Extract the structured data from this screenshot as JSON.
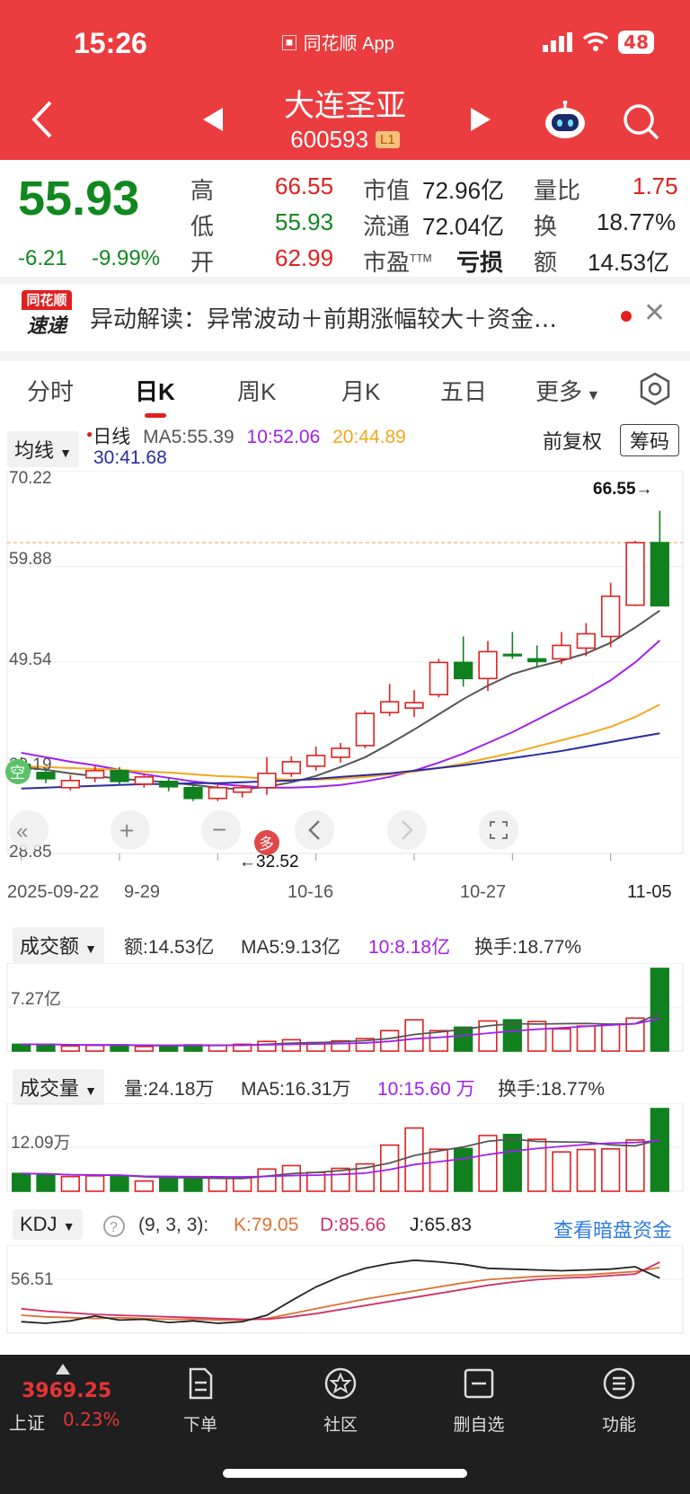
{
  "status": {
    "time": "15:26",
    "app": "同花顺 App",
    "battery": "48"
  },
  "header": {
    "name": "大连圣亚",
    "code": "600593",
    "level_badge": "L1"
  },
  "quote": {
    "price": "55.93",
    "change": "-6.21",
    "change_pct": "-9.99%",
    "high_label": "高",
    "high": "66.55",
    "low_label": "低",
    "low": "55.93",
    "open_label": "开",
    "open": "62.99",
    "mktcap_label": "市值",
    "mktcap": "72.96亿",
    "float_label": "流通",
    "float": "72.04亿",
    "pe_label": "市盈",
    "pe_sup": "TTM",
    "pe": "亏损",
    "volratio_label": "量比",
    "volratio": "1.75",
    "turnover_label": "换",
    "turnover": "18.77%",
    "amount_label": "额",
    "amount": "14.53亿"
  },
  "news": {
    "logo_top": "同花顺",
    "logo_bottom": "速递",
    "text": "异动解读：异常波动＋前期涨幅较大＋资金…"
  },
  "tabs": [
    "分时",
    "日K",
    "周K",
    "月K",
    "五日",
    "更多"
  ],
  "kline": {
    "dropdown": "均线",
    "series_label": "日线",
    "ma5": "MA5:55.39",
    "ma10": "10:52.06",
    "ma20": "20:44.89",
    "ma30": "30:41.68",
    "adjust": "前复权",
    "chip_button": "筹码",
    "y_labels": [
      "70.22",
      "59.88",
      "49.54",
      "39.19",
      "28.85"
    ],
    "x_labels": [
      "2025-09-22",
      "9-29",
      "10-16",
      "10-27",
      "11-05"
    ],
    "high_marker": "66.55→",
    "low_marker": "←32.52",
    "signal_kong": "空",
    "signal_duo": "多",
    "colors": {
      "up": "#e02020",
      "down": "#11801f",
      "ma5": "#555555",
      "ma10": "#a020f0",
      "ma20": "#f2a81d",
      "ma30": "#2b2ba0"
    }
  },
  "chart_data": [
    {
      "type": "candlestick",
      "title": "日线",
      "x_ticks": [
        "2025-09-22",
        "9-29",
        "10-16",
        "10-27",
        "11-05"
      ],
      "ylim": [
        28.85,
        70.22
      ],
      "candles": [
        {
          "o": 38.2,
          "c": 37.5,
          "h": 39.0,
          "l": 36.8
        },
        {
          "o": 37.3,
          "c": 36.6,
          "h": 37.8,
          "l": 36.1
        },
        {
          "o": 35.6,
          "c": 36.4,
          "h": 37.0,
          "l": 35.3
        },
        {
          "o": 36.7,
          "c": 37.5,
          "h": 38.1,
          "l": 36.2
        },
        {
          "o": 37.5,
          "c": 36.3,
          "h": 37.9,
          "l": 35.9
        },
        {
          "o": 36.0,
          "c": 36.8,
          "h": 37.2,
          "l": 35.6
        },
        {
          "o": 36.3,
          "c": 35.7,
          "h": 36.7,
          "l": 35.2
        },
        {
          "o": 35.6,
          "c": 34.4,
          "h": 35.9,
          "l": 34.1
        },
        {
          "o": 34.4,
          "c": 35.6,
          "h": 35.9,
          "l": 34.1
        },
        {
          "o": 35.1,
          "c": 35.6,
          "h": 35.9,
          "l": 34.5
        },
        {
          "o": 35.6,
          "c": 37.2,
          "h": 39.0,
          "l": 34.8
        },
        {
          "o": 37.2,
          "c": 38.5,
          "h": 39.1,
          "l": 36.8
        },
        {
          "o": 38.0,
          "c": 39.2,
          "h": 40.2,
          "l": 37.5
        },
        {
          "o": 39.0,
          "c": 40.0,
          "h": 40.6,
          "l": 38.4
        },
        {
          "o": 40.3,
          "c": 43.9,
          "h": 44.2,
          "l": 40.0
        },
        {
          "o": 44.0,
          "c": 45.2,
          "h": 47.2,
          "l": 43.6
        },
        {
          "o": 44.5,
          "c": 45.1,
          "h": 46.5,
          "l": 43.5
        },
        {
          "o": 46.0,
          "c": 49.6,
          "h": 50.0,
          "l": 45.7
        },
        {
          "o": 49.6,
          "c": 47.8,
          "h": 52.5,
          "l": 46.9
        },
        {
          "o": 47.8,
          "c": 50.8,
          "h": 52.0,
          "l": 46.4
        },
        {
          "o": 50.5,
          "c": 50.4,
          "h": 53.0,
          "l": 50.0
        },
        {
          "o": 50.0,
          "c": 49.7,
          "h": 51.5,
          "l": 49.0
        },
        {
          "o": 50.0,
          "c": 51.5,
          "h": 53.0,
          "l": 49.4
        },
        {
          "o": 51.2,
          "c": 52.8,
          "h": 54.0,
          "l": 50.3
        },
        {
          "o": 52.5,
          "c": 57.0,
          "h": 58.5,
          "l": 51.3
        },
        {
          "o": 56.0,
          "c": 62.99,
          "h": 63.2,
          "l": 55.9
        },
        {
          "o": 62.99,
          "c": 55.93,
          "h": 66.55,
          "l": 55.93
        }
      ],
      "series": [
        {
          "name": "MA5",
          "values": [
            37.9,
            37.6,
            37.2,
            36.9,
            36.6,
            36.4,
            36.2,
            35.9,
            35.6,
            35.4,
            35.7,
            36.2,
            36.9,
            37.9,
            39.0,
            40.5,
            42.1,
            43.8,
            45.5,
            47.0,
            48.3,
            49.1,
            49.8,
            50.6,
            51.8,
            53.5,
            55.39
          ]
        },
        {
          "name": "MA10",
          "values": [
            39.5,
            39.0,
            38.5,
            38.1,
            37.6,
            37.1,
            36.7,
            36.3,
            36.0,
            35.8,
            35.6,
            35.6,
            35.7,
            35.9,
            36.3,
            36.8,
            37.5,
            38.4,
            39.4,
            40.6,
            41.8,
            43.2,
            44.6,
            46.0,
            47.6,
            49.6,
            52.06
          ]
        },
        {
          "name": "MA20",
          "values": [
            38.0,
            37.9,
            37.8,
            37.7,
            37.6,
            37.4,
            37.3,
            37.1,
            36.9,
            36.8,
            36.6,
            36.5,
            36.5,
            36.6,
            36.8,
            37.1,
            37.4,
            37.8,
            38.3,
            38.9,
            39.5,
            40.2,
            40.9,
            41.6,
            42.4,
            43.5,
            44.89
          ]
        },
        {
          "name": "MA30",
          "values": [
            35.5,
            35.6,
            35.7,
            35.8,
            35.9,
            36.0,
            36.0,
            36.1,
            36.1,
            36.2,
            36.3,
            36.4,
            36.6,
            36.8,
            37.0,
            37.2,
            37.5,
            37.8,
            38.1,
            38.5,
            38.9,
            39.3,
            39.7,
            40.2,
            40.7,
            41.2,
            41.68
          ]
        }
      ]
    },
    {
      "type": "bar",
      "title": "成交额",
      "ylabel": "7.27亿",
      "values": [
        1.2,
        1.2,
        0.9,
        1.0,
        1.1,
        0.8,
        1.0,
        1.1,
        1.0,
        1.2,
        1.7,
        2.0,
        1.5,
        1.8,
        2.2,
        3.6,
        5.5,
        3.6,
        4.2,
        5.3,
        5.5,
        5.2,
        3.9,
        4.4,
        4.7,
        5.8,
        14.53
      ],
      "up": [
        false,
        false,
        true,
        true,
        false,
        true,
        false,
        false,
        true,
        true,
        true,
        true,
        true,
        true,
        true,
        true,
        true,
        true,
        false,
        true,
        false,
        true,
        true,
        true,
        true,
        true,
        false
      ]
    },
    {
      "type": "bar",
      "title": "成交量",
      "ylabel": "12.09万",
      "values": [
        5.2,
        5.0,
        4.3,
        4.5,
        4.4,
        3.0,
        3.8,
        3.9,
        3.9,
        4.0,
        6.5,
        7.5,
        5.5,
        6.7,
        8.0,
        13.5,
        18.5,
        12.3,
        12.5,
        16.3,
        16.6,
        15.2,
        11.5,
        12.2,
        12.4,
        15.0,
        24.18
      ],
      "up": [
        false,
        false,
        true,
        true,
        false,
        true,
        false,
        false,
        true,
        true,
        true,
        true,
        true,
        true,
        true,
        true,
        true,
        true,
        false,
        true,
        false,
        true,
        true,
        true,
        true,
        true,
        false
      ]
    },
    {
      "type": "line",
      "title": "KDJ",
      "ylabel": "56.51",
      "series": [
        {
          "name": "K",
          "values": [
            20,
            18,
            17,
            16,
            17,
            16,
            15,
            15,
            14,
            14,
            16,
            22,
            28,
            34,
            40,
            45,
            50,
            55,
            60,
            64,
            66,
            68,
            69,
            70,
            72,
            74,
            79.05
          ]
        },
        {
          "name": "D",
          "values": [
            28,
            25,
            23,
            21,
            20,
            19,
            18,
            17,
            16,
            15,
            15,
            18,
            22,
            27,
            32,
            37,
            42,
            47,
            52,
            57,
            61,
            64,
            66,
            67,
            69,
            71,
            85.66
          ]
        },
        {
          "name": "J",
          "values": [
            12,
            10,
            13,
            19,
            14,
            15,
            11,
            13,
            10,
            12,
            20,
            38,
            55,
            68,
            78,
            84,
            88,
            86,
            83,
            78,
            77,
            76,
            75,
            76,
            77,
            80,
            65.83
          ]
        }
      ]
    }
  ],
  "amount_panel": {
    "dropdown": "成交额",
    "amount": "额:14.53亿",
    "ma5": "MA5:9.13亿",
    "ma10": "10:8.18亿",
    "turnover": "换手:18.77%",
    "y_label": "7.27亿"
  },
  "volume_panel": {
    "dropdown": "成交量",
    "volume": "量:24.18万",
    "ma5": "MA5:16.31万",
    "ma10": "10:15.60 万",
    "turnover": "换手:18.77%",
    "y_label": "12.09万"
  },
  "kdj_panel": {
    "dropdown": "KDJ",
    "params": "(9, 3, 3):",
    "k": "K:79.05",
    "d": "D:85.66",
    "j": "J:65.83",
    "link": "查看暗盘资金",
    "y_label": "56.51",
    "help": "?"
  },
  "bottom_nav": {
    "index_value": "3969.25",
    "index_name": "上证",
    "index_pct": "0.23%",
    "items": [
      "下单",
      "社区",
      "删自选",
      "功能"
    ]
  }
}
